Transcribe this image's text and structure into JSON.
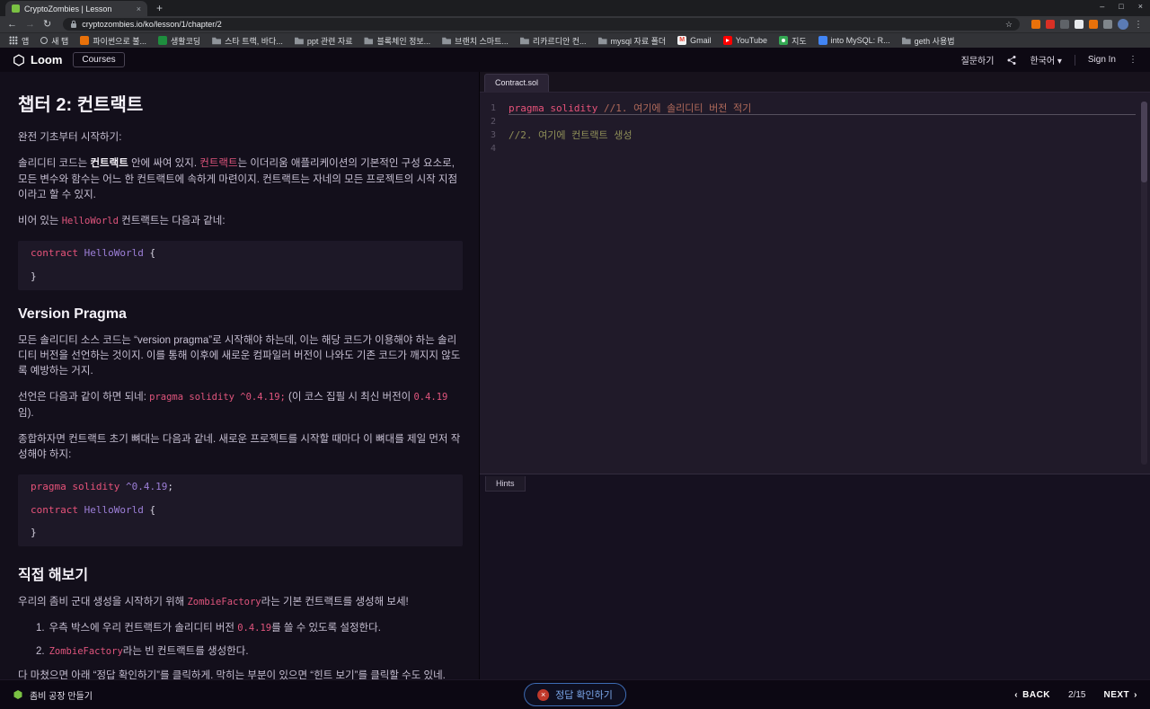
{
  "browser": {
    "tab_title": "CryptoZombies | Lesson",
    "url": "cryptozombies.io/ko/lesson/1/chapter/2",
    "bookmarks": [
      {
        "label": "앱",
        "icon": "apps-grid"
      },
      {
        "label": "새 탭",
        "icon": "globe"
      },
      {
        "label": "파이썬으로 불...",
        "icon": "page-orange"
      },
      {
        "label": "생활코딩",
        "icon": "page-green"
      },
      {
        "label": "스타 트랙, 바다...",
        "icon": "folder"
      },
      {
        "label": "ppt 관련 자료",
        "icon": "folder"
      },
      {
        "label": "블록체인 정보...",
        "icon": "folder"
      },
      {
        "label": "브랜치 스마트...",
        "icon": "folder"
      },
      {
        "label": "리카르디안 컨...",
        "icon": "folder"
      },
      {
        "label": "mysql 자료 폴더",
        "icon": "folder"
      },
      {
        "label": "Gmail",
        "icon": "gmail"
      },
      {
        "label": "YouTube",
        "icon": "youtube"
      },
      {
        "label": "지도",
        "icon": "map"
      },
      {
        "label": "into MySQL: R...",
        "icon": "page-blue"
      },
      {
        "label": "geth 사용법",
        "icon": "folder"
      }
    ]
  },
  "header": {
    "logo": "Loom",
    "courses": "Courses",
    "ask": "질문하기",
    "lang": "한국어",
    "caret": "▾",
    "signin": "Sign In"
  },
  "content": {
    "title": "챕터 2: 컨트랙트",
    "p1": "완전 기초부터 시작하기:",
    "p2": [
      "솔리디티 코드는 ",
      "컨트랙트",
      " 안에 싸여 있지. ",
      "컨트랙트",
      "는 이더리움 애플리케이션의 기본적인 구성 요소로, 모든 변수와 함수는 어느 한 컨트랙트에 속하게 마련이지. 컨트랙트는 자네의 모든 프로젝트의 시작 지점이라고 할 수 있지."
    ],
    "p3": [
      "비어 있는 ",
      "HelloWorld",
      " 컨트랙트는 다음과 같네:"
    ],
    "code1": {
      "kw": "contract",
      "id": " HelloWorld",
      "open": " {",
      "close": "}"
    },
    "h2": "Version Pragma",
    "p4": "모든 솔리디티 소스 코드는 “version pragma”로 시작해야 하는데, 이는 해당 코드가 이용해야 하는 솔리디티 버전을 선언하는 것이지. 이를 통해 이후에 새로운 컴파일러 버전이 나와도 기존 코드가 깨지지 않도록 예방하는 거지.",
    "p5": [
      "선언은 다음과 같이 하면 되네: ",
      "pragma solidity ^0.4.19;",
      " (이 코스 집필 시 최신 버전이 ",
      "0.4.19",
      "임)."
    ],
    "p6": "종합하자면 컨트랙트 초기 뼈대는 다음과 같네. 새로운 프로젝트를 시작할 때마다 이 뼈대를 제일 먼저 작성해야 하지:",
    "code2": {
      "kw1": "pragma solidity ",
      "ver": "^0.4.19",
      "semi": ";",
      "kw2": "contract",
      "id": " HelloWorld",
      "open": " {",
      "close": "}"
    },
    "h3": "직접 해보기",
    "p7": [
      "우리의 좀비 군대 생성을 시작하기 위해 ",
      "ZombieFactory",
      "라는 기본 컨트랙트를 생성해 보세!"
    ],
    "list1_num": "1.",
    "list1": [
      "우측 박스에 우리 컨트랙트가 솔리디티 버전 ",
      "0.4.19",
      "를 쓸 수 있도록 설정한다."
    ],
    "list2_num": "2.",
    "list2": [
      "ZombieFactory",
      "라는 빈 컨트랙트를 생성한다."
    ],
    "p8": "다 마쳤으면 아래 “정답 확인하기”를 클릭하게. 막히는 부분이 있으면 “힌트 보기”를 클릭할 수도 있네."
  },
  "editor": {
    "tab": "Contract.sol",
    "hints_tab": "Hints",
    "lines": [
      {
        "num": "1",
        "keyword": "pragma solidity ",
        "comment": "//1. 여기에 솔리디티 버전 적기"
      },
      {
        "num": "2"
      },
      {
        "num": "3",
        "comment": "//2. 여기에 컨트랙트 생성"
      },
      {
        "num": "4"
      }
    ]
  },
  "footer": {
    "chapter": "좀비 공장 만들기",
    "check": "정답 확인하기",
    "check_icon": "×",
    "back_arrow": "‹",
    "back": "BACK",
    "progress": "2/15",
    "next": "NEXT",
    "next_arrow": "›"
  },
  "colors": {
    "keyword_pink": "#e8537a",
    "identifier_purple": "#9d7fd8",
    "comment_olive": "#8f8f58",
    "comment_red": "#b06a5a",
    "button_blue": "#7aa5e8",
    "editor_bg": "#201a29",
    "page_bg": "#130f1b",
    "zombie_green": "#7ac143"
  }
}
